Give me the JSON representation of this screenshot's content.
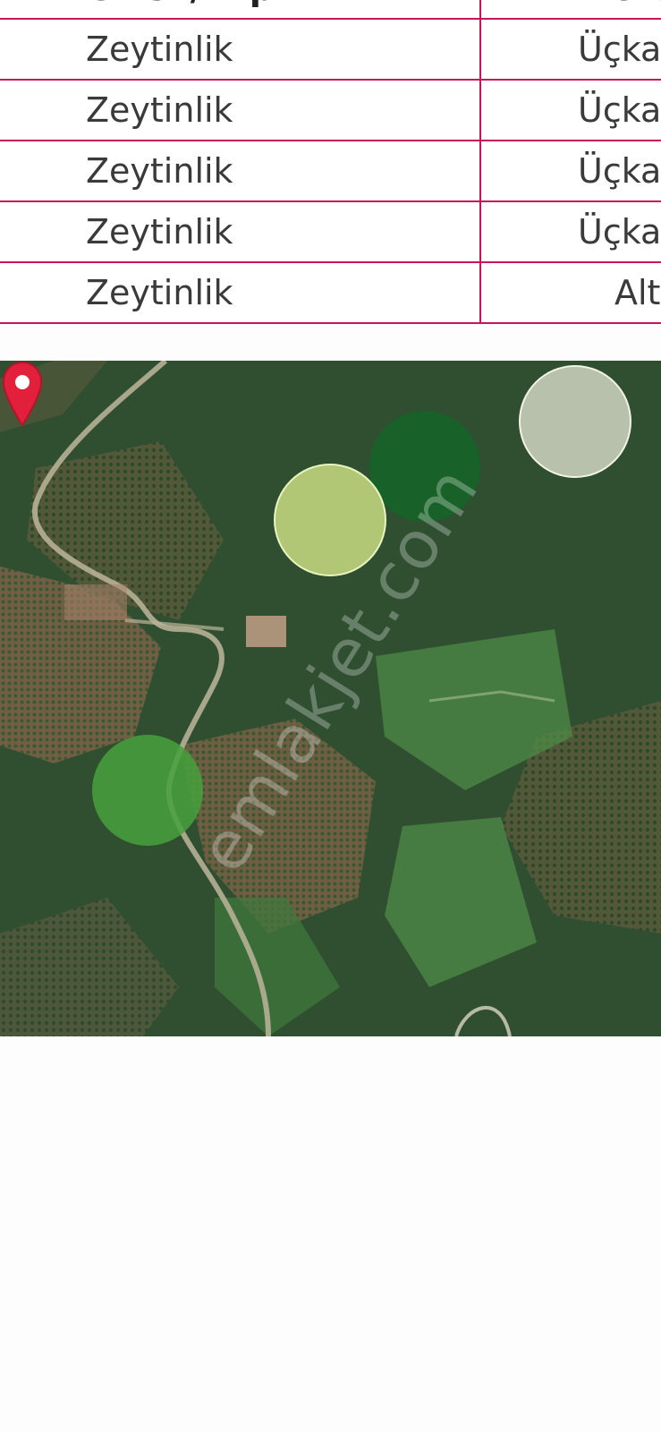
{
  "table": {
    "header": {
      "col_a": "Cinsi / Tip",
      "col_b": "Mevkii"
    },
    "rows": [
      {
        "col_a": "Zeytinlik",
        "col_b": "Üçka"
      },
      {
        "col_a": "Zeytinlik",
        "col_b": "Üçka"
      },
      {
        "col_a": "Zeytinlik",
        "col_b": "Üçka"
      },
      {
        "col_a": "Zeytinlik",
        "col_b": "Üçka"
      },
      {
        "col_a": "Zeytinlik",
        "col_b": "Alt"
      }
    ],
    "border_color": "#c8145a"
  },
  "map": {
    "watermark": "emlakjet.com",
    "marker_icon": "location-pin-icon",
    "marker_color": "#e3203c"
  }
}
